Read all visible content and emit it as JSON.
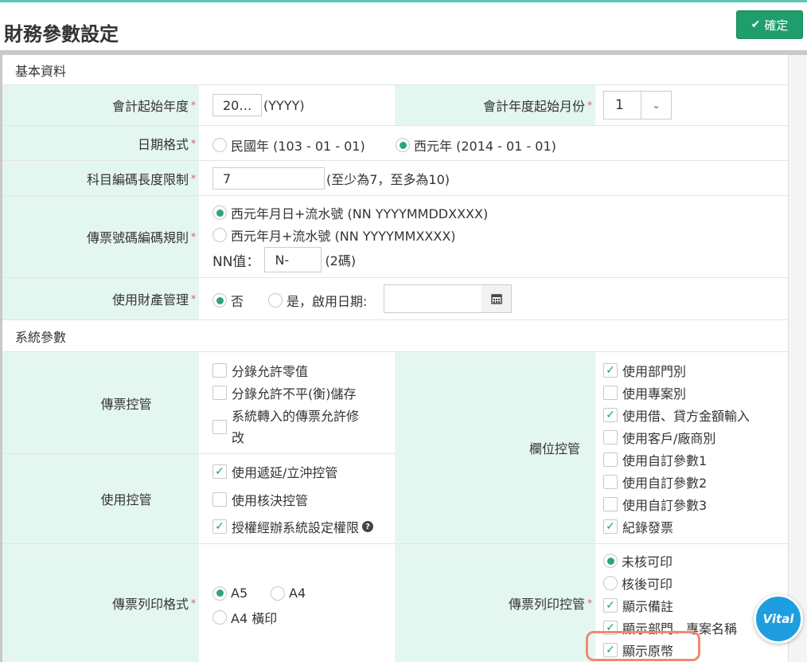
{
  "header": {
    "title": "財務參數設定",
    "ok_label": "確定",
    "ok_icon": "check-icon"
  },
  "sections": {
    "basic": "基本資料",
    "system": "系統參數"
  },
  "required_mark": "*",
  "fiscal_year": {
    "label": "會計起始年度",
    "value": "20…",
    "suffix": "(YYYY)"
  },
  "fiscal_month": {
    "label": "會計年度起始月份",
    "value": "1"
  },
  "date_format": {
    "label": "日期格式",
    "options": [
      "民國年 (103 - 01 - 01)",
      "西元年 (2014 - 01 - 01)"
    ],
    "selected": 1
  },
  "code_length": {
    "label": "科目編碼長度限制",
    "value": "7",
    "hint": "(至少為7，至多為10)"
  },
  "voucher_rule": {
    "label": "傳票號碼編碼規則",
    "options": [
      "西元年月日+流水號 (NN YYYYMMDDXXXX)",
      "西元年月+流水號 (NN YYYYMMXXXX)"
    ],
    "selected": 0,
    "nn_label": "NN值：",
    "nn_value": "N-",
    "nn_hint": "(2碼)"
  },
  "property": {
    "label": "使用財產管理",
    "no": "否",
    "yes": "是，啟用日期:",
    "selected": 0
  },
  "voucher_control": {
    "label": "傳票控管",
    "items": [
      {
        "text": "分錄允許零值",
        "checked": false
      },
      {
        "text": "分錄允許不平(衡)儲存",
        "checked": false
      },
      {
        "text_line1": "系統轉入的傳票允許修",
        "text_line2": "改",
        "checked": false
      }
    ]
  },
  "use_control": {
    "label": "使用控管",
    "items": [
      {
        "text": "使用遞延/立沖控管",
        "checked": true
      },
      {
        "text": "使用核決控管",
        "checked": false
      },
      {
        "text": "授權經辦系統設定權限",
        "checked": true
      }
    ]
  },
  "field_control": {
    "label": "欄位控管",
    "items": [
      {
        "text": "使用部門別",
        "checked": true
      },
      {
        "text": "使用專案別",
        "checked": false
      },
      {
        "text": "使用借、貸方金額輸入",
        "checked": true
      },
      {
        "text": "使用客戶/廠商別",
        "checked": false
      },
      {
        "text": "使用自訂參數1",
        "checked": false
      },
      {
        "text": "使用自訂參數2",
        "checked": false
      },
      {
        "text": "使用自訂參數3",
        "checked": false
      },
      {
        "text": "紀錄發票",
        "checked": true
      }
    ]
  },
  "print_format": {
    "label": "傳票列印格式",
    "options": [
      "A5",
      "A4",
      "A4 橫印"
    ],
    "selected": 0
  },
  "print_control": {
    "label": "傳票列印控管",
    "radios": [
      {
        "text": "未核可印",
        "selected": true
      },
      {
        "text": "核後可印",
        "selected": false
      }
    ],
    "checks": [
      {
        "text": "顯示備註",
        "checked": true
      },
      {
        "text": "顯示部門、專案名稱",
        "checked": true
      },
      {
        "text": "顯示原幣",
        "checked": true
      }
    ]
  },
  "widget": {
    "label": "Vital"
  },
  "colors": {
    "accent": "#2ca57f",
    "button": "#1f9d6c",
    "label_bg": "#e4f6f0",
    "required": "#e8564f",
    "highlight": "#f08a6e"
  }
}
